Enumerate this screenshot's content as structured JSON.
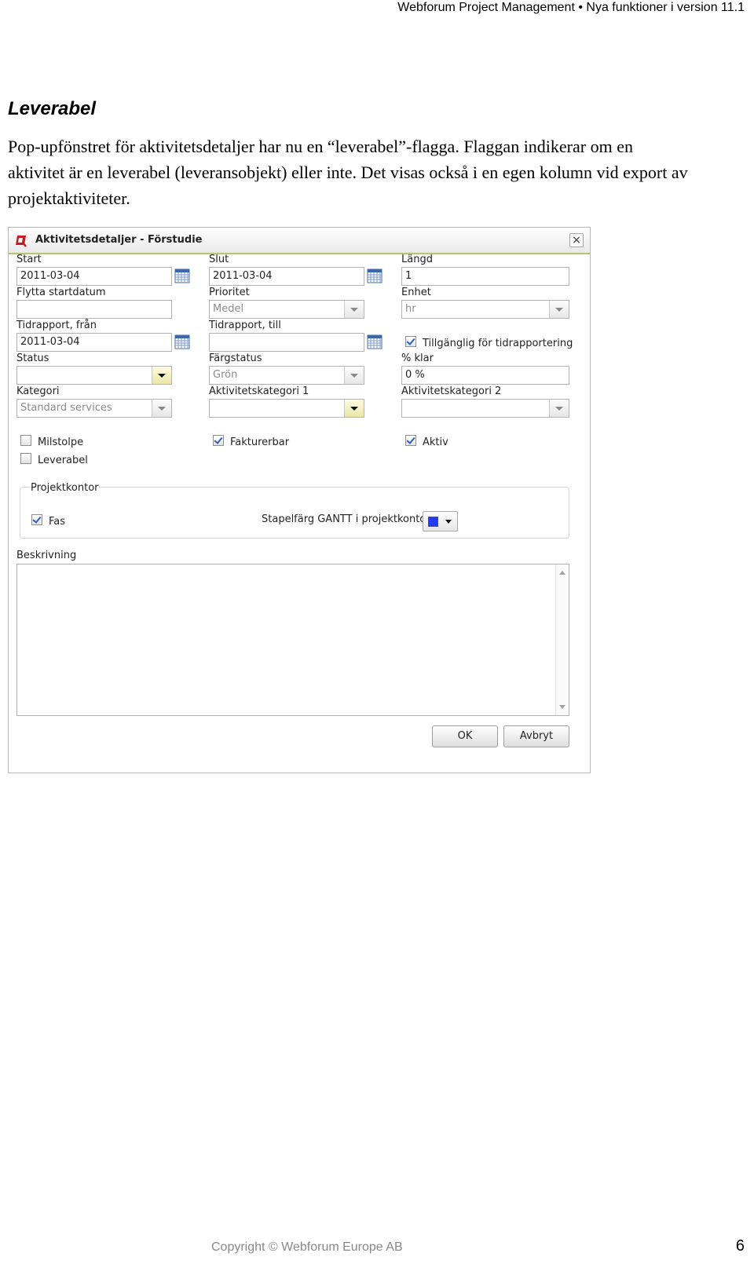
{
  "header": {
    "title": "Webforum Project Management",
    "separator": "•",
    "subtitle": "Nya funktioner i version 11.1"
  },
  "section": {
    "heading": "Leverabel",
    "paragraph": "Pop-upfönstret för aktivitetsdetaljer har nu en “leverabel”-flagga. Flaggan indikerar om en aktivitet är en leverabel (leveransobjekt) eller inte. Det visas också i en egen kolumn vid export av projektaktiviteter."
  },
  "dialog": {
    "title": "Aktivitetsdetaljer - Förstudie",
    "close_label": "×",
    "fields": {
      "start": {
        "label": "Start",
        "value": "2011-03-04"
      },
      "slut": {
        "label": "Slut",
        "value": "2011-03-04"
      },
      "langd": {
        "label": "Längd",
        "value": "1"
      },
      "flytta_startdatum": {
        "label": "Flytta startdatum",
        "value": ""
      },
      "prioritet": {
        "label": "Prioritet",
        "value": "Medel"
      },
      "enhet": {
        "label": "Enhet",
        "value": "hr"
      },
      "tidrapport_fran": {
        "label": "Tidrapport, från",
        "value": "2011-03-04"
      },
      "tidrapport_till": {
        "label": "Tidrapport, till",
        "value": ""
      },
      "tillganglig": {
        "label": "Tillgänglig för tidrapportering",
        "checked": true
      },
      "status": {
        "label": "Status",
        "value": ""
      },
      "fargstatus": {
        "label": "Färgstatus",
        "value": "Grön"
      },
      "procent_klar": {
        "label": "% klar",
        "value": "0 %"
      },
      "kategori": {
        "label": "Kategori",
        "value": "Standard services"
      },
      "aktivitetskategori1": {
        "label": "Aktivitetskategori 1",
        "value": ""
      },
      "aktivitetskategori2": {
        "label": "Aktivitetskategori 2",
        "value": ""
      }
    },
    "checkboxes": {
      "milstolpe": {
        "label": "Milstolpe",
        "checked": false
      },
      "leverabel": {
        "label": "Leverabel",
        "checked": false
      },
      "fakturerbar": {
        "label": "Fakturerbar",
        "checked": true
      },
      "aktiv": {
        "label": "Aktiv",
        "checked": true
      }
    },
    "projektkontor": {
      "legend": "Projektkontor",
      "fas": {
        "label": "Fas",
        "checked": true
      },
      "bar_color_label": "Stapelfärg GANTT i projektkontor",
      "bar_color": "#1f3bf5"
    },
    "beskrivning": {
      "label": "Beskrivning",
      "value": ""
    },
    "buttons": {
      "ok": "OK",
      "cancel": "Avbryt"
    }
  },
  "footer": {
    "copyright": "Copyright © Webforum Europe AB",
    "page_number": "6"
  }
}
